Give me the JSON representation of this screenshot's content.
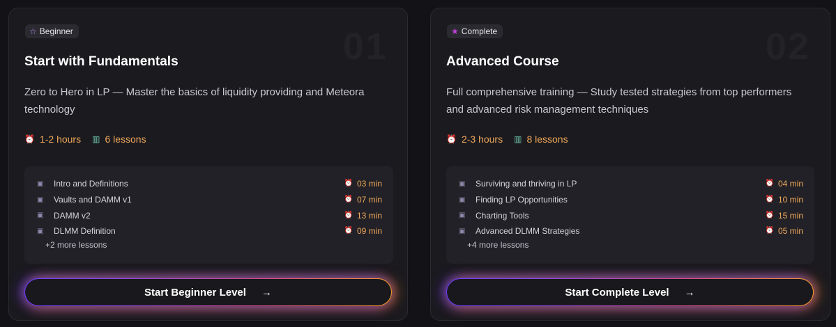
{
  "cards": [
    {
      "badge": "Beginner",
      "number": "01",
      "title": "Start with Fundamentals",
      "description": "Zero to Hero in LP — Master the basics of liquidity providing and Meteora technology",
      "duration": "1-2 hours",
      "lessons_count": "6 lessons",
      "lessons": [
        {
          "name": "Intro and Definitions",
          "duration": "03 min"
        },
        {
          "name": "Vaults and DAMM v1",
          "duration": "07 min"
        },
        {
          "name": "DAMM v2",
          "duration": "13 min"
        },
        {
          "name": "DLMM Definition",
          "duration": "09 min"
        }
      ],
      "more": "+2 more lessons",
      "cta": "Start Beginner Level"
    },
    {
      "badge": "Complete",
      "number": "02",
      "title": "Advanced Course",
      "description": "Full comprehensive training — Study tested strategies from top performers and advanced risk management techniques",
      "duration": "2-3 hours",
      "lessons_count": "8 lessons",
      "lessons": [
        {
          "name": "Surviving and thriving in LP",
          "duration": "04 min"
        },
        {
          "name": "Finding LP Opportunities",
          "duration": "10 min"
        },
        {
          "name": "Charting Tools",
          "duration": "15 min"
        },
        {
          "name": "Advanced DLMM Strategies",
          "duration": "05 min"
        }
      ],
      "more": "+4 more lessons",
      "cta": "Start Complete Level"
    }
  ],
  "icons": {
    "star": "star-icon",
    "clock": "alarm-clock-icon",
    "books": "books-icon",
    "lesson": "video-icon",
    "arrow": "arrow-right-icon"
  },
  "colors": {
    "background": "#131216",
    "card": "#1b1a1f",
    "accent_orange": "#efa85a",
    "gradient_start": "#6a3dff",
    "gradient_end": "#f59a2c"
  }
}
